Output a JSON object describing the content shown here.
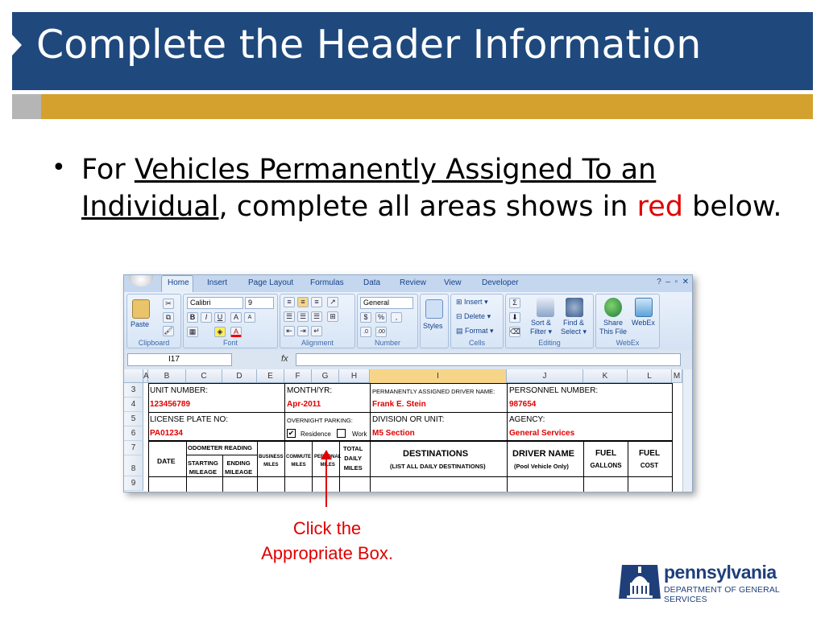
{
  "slide": {
    "title": "Complete the Header Information",
    "bullet": {
      "lead": "For ",
      "underlined": "Vehicles Permanently Assigned To an Individual",
      "middle": ", complete all areas shows in ",
      "red_word": "red",
      "tail": " below."
    },
    "callout": [
      "Click the",
      "Appropriate Box."
    ],
    "logo": {
      "name": "pennsylvania",
      "dept": "DEPARTMENT OF GENERAL SERVICES"
    },
    "colors": {
      "title_bg": "#1f497d",
      "gold_bar": "#d4a12e",
      "accent_red": "#e00000"
    }
  },
  "excel": {
    "tabs": [
      "Home",
      "Insert",
      "Page Layout",
      "Formulas",
      "Data",
      "Review",
      "View",
      "Developer"
    ],
    "groups": [
      "Clipboard",
      "Font",
      "Alignment",
      "Number",
      "Cells",
      "Editing",
      "WebEx"
    ],
    "font_name": "Calibri",
    "font_size": "9",
    "number_format": "General",
    "buttons": {
      "paste": "Paste",
      "insert": "Insert",
      "delete": "Delete",
      "format": "Format",
      "styles": "Styles",
      "sort_filter": [
        "Sort &",
        "Filter"
      ],
      "find_select": [
        "Find &",
        "Select"
      ],
      "share": [
        "Share",
        "This File"
      ],
      "webex": "WebEx"
    },
    "name_box": "I17",
    "fx": "fx",
    "columns": [
      "A",
      "B",
      "C",
      "D",
      "E",
      "F",
      "G",
      "H",
      "I",
      "J",
      "K",
      "L",
      "M"
    ],
    "rows": [
      "3",
      "4",
      "5",
      "6",
      "7",
      "8",
      "9"
    ],
    "form": {
      "unit_number_label": "UNIT NUMBER:",
      "unit_number": "123456789",
      "month_yr_label": "MONTH/YR:",
      "month_yr": "Apr-2011",
      "driver_label": "PERMANENTLY ASSIGNED DRIVER NAME:",
      "driver": "Frank E. Stein",
      "personnel_label": "PERSONNEL NUMBER:",
      "personnel": "987654",
      "plate_label": "LICENSE PLATE NO:",
      "plate": "PA01234",
      "parking_label": "OVERNIGHT PARKING:",
      "residence": "Residence",
      "work": "Work",
      "division_label": "DIVISION OR UNIT:",
      "division": "M5 Section",
      "agency_label": "AGENCY:",
      "agency": "General Services",
      "date": "DATE",
      "odometer": "ODOMETER READING",
      "starting": [
        "STARTING",
        "MILEAGE"
      ],
      "ending": [
        "ENDING",
        "MILEAGE"
      ],
      "business": [
        "BUSINESS",
        "MILES"
      ],
      "commute": [
        "COMMUTE",
        "MILES"
      ],
      "personal": [
        "PERSONAL",
        "MILES"
      ],
      "total": [
        "TOTAL",
        "DAILY",
        "MILES"
      ],
      "destinations": "DESTINATIONS",
      "destinations_sub": "(LIST ALL DAILY DESTINATIONS)",
      "driver_name": "DRIVER NAME",
      "driver_name_sub": "(Pool Vehicle Only)",
      "fuel1": [
        "FUEL",
        "GALLONS"
      ],
      "fuel2": [
        "FUEL",
        "COST"
      ]
    }
  }
}
